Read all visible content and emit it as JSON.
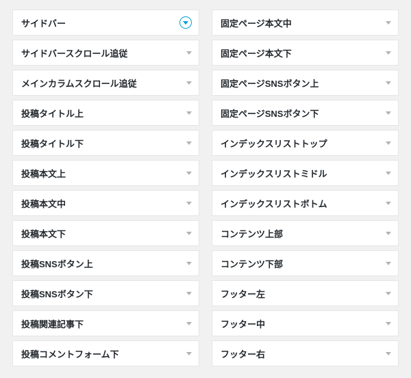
{
  "left": [
    {
      "label": "サイドバー",
      "active": true
    },
    {
      "label": "サイドバースクロール追従",
      "active": false
    },
    {
      "label": "メインカラムスクロール追従",
      "active": false
    },
    {
      "label": "投稿タイトル上",
      "active": false
    },
    {
      "label": "投稿タイトル下",
      "active": false
    },
    {
      "label": "投稿本文上",
      "active": false
    },
    {
      "label": "投稿本文中",
      "active": false
    },
    {
      "label": "投稿本文下",
      "active": false
    },
    {
      "label": "投稿SNSボタン上",
      "active": false
    },
    {
      "label": "投稿SNSボタン下",
      "active": false
    },
    {
      "label": "投稿関連記事下",
      "active": false
    },
    {
      "label": "投稿コメントフォーム下",
      "active": false
    }
  ],
  "right": [
    {
      "label": "固定ページ本文中",
      "active": false
    },
    {
      "label": "固定ページ本文下",
      "active": false
    },
    {
      "label": "固定ページSNSボタン上",
      "active": false
    },
    {
      "label": "固定ページSNSボタン下",
      "active": false
    },
    {
      "label": "インデックスリストトップ",
      "active": false
    },
    {
      "label": "インデックスリストミドル",
      "active": false
    },
    {
      "label": "インデックスリストボトム",
      "active": false
    },
    {
      "label": "コンテンツ上部",
      "active": false
    },
    {
      "label": "コンテンツ下部",
      "active": false
    },
    {
      "label": "フッター左",
      "active": false
    },
    {
      "label": "フッター中",
      "active": false
    },
    {
      "label": "フッター右",
      "active": false
    }
  ]
}
